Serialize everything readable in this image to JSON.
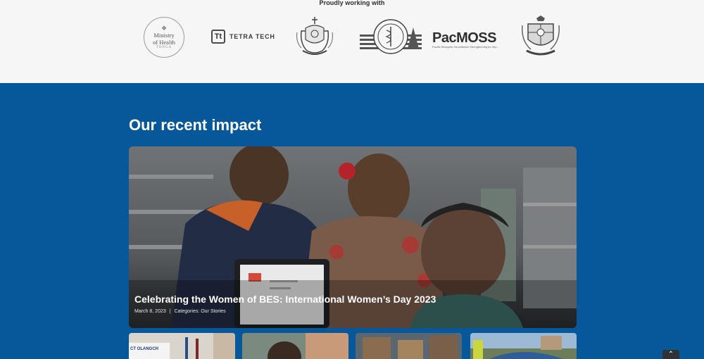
{
  "partners": {
    "title": "Proudly working with",
    "logos": {
      "moh_line1": "Ministry",
      "moh_line2": "of Health",
      "moh_line3": "TONGA",
      "tetra_mark": "Tt",
      "tetra_word": "TETRA TECH",
      "pacmoss_word": "PacMOSS",
      "pacmoss_sub": "Pacific Mosquito Surveillance Strengthening for Imp..."
    }
  },
  "impact": {
    "title": "Our recent impact",
    "featured": {
      "title": "Celebrating the Women of BES: International Women’s Day 2023",
      "date": "March 8, 2023",
      "separator": "|",
      "categories": "Categories: Our Stories"
    },
    "thumb_caption_1": "CT OLANGCH"
  },
  "icons": {
    "scroll_top": "chevron-up-icon"
  }
}
